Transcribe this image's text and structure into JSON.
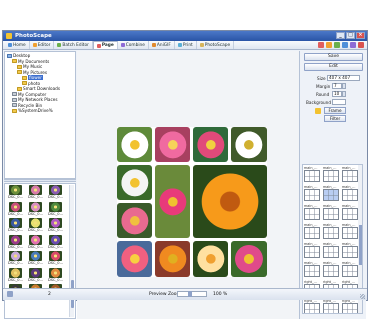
{
  "window": {
    "title": "PhotoScape"
  },
  "tabs": [
    {
      "label": "Home",
      "color": "#4f8fd9"
    },
    {
      "label": "Editor",
      "color": "#f0a030"
    },
    {
      "label": "Batch Editor",
      "color": "#6ab04c"
    },
    {
      "label": "Page",
      "color": "#e05d5d"
    },
    {
      "label": "Combine",
      "color": "#8e6bd6"
    },
    {
      "label": "AniGIF",
      "color": "#e08a2e"
    },
    {
      "label": "Print",
      "color": "#5bb0d6"
    },
    {
      "label": "PhotoScape",
      "color": "#d6b45b"
    }
  ],
  "tree": [
    {
      "label": "Desktop",
      "indent": 0,
      "kind": "blue"
    },
    {
      "label": "My Documents",
      "indent": 1,
      "kind": "yellow"
    },
    {
      "label": "My Music",
      "indent": 2,
      "kind": "yellow"
    },
    {
      "label": "My Pictures",
      "indent": 2,
      "kind": "yellow"
    },
    {
      "label": "flower",
      "indent": 3,
      "kind": "yellow",
      "selected": true
    },
    {
      "label": "photo",
      "indent": 3,
      "kind": "yellow"
    },
    {
      "label": "Smart Downloads",
      "indent": 2,
      "kind": "yellow"
    },
    {
      "label": "My Computer",
      "indent": 1,
      "kind": "gray"
    },
    {
      "label": "My Network Places",
      "indent": 1,
      "kind": "gray"
    },
    {
      "label": "Recycle Bin",
      "indent": 1,
      "kind": "gray"
    },
    {
      "label": "%SystemDrive%",
      "indent": 1,
      "kind": "yellow"
    }
  ],
  "thumbnails": [
    {
      "caption": "DSC_0...",
      "color": "#6a8e3a"
    },
    {
      "caption": "DSC_0...",
      "color": "#d67aa8"
    },
    {
      "caption": "DSC_0...",
      "color": "#8a5ab0"
    },
    {
      "caption": "DSC_0...",
      "color": "#c94f7a"
    },
    {
      "caption": "DSC_0...",
      "color": "#d88fc0"
    },
    {
      "caption": "DSC_0...",
      "color": "#4f8a3e"
    },
    {
      "caption": "DSC_0...",
      "color": "#3a5aa0"
    },
    {
      "caption": "DSC_0...",
      "color": "#e8e070"
    },
    {
      "caption": "DSC_0...",
      "color": "#b05ac0"
    },
    {
      "caption": "DSC_0...",
      "color": "#9a3a8a"
    },
    {
      "caption": "DSC_0...",
      "color": "#e070b0"
    },
    {
      "caption": "DSC_0...",
      "color": "#6a4ab0"
    },
    {
      "caption": "DSC_0...",
      "color": "#c8a8d8"
    },
    {
      "caption": "DSC_0...",
      "color": "#4a7ab8"
    },
    {
      "caption": "DSC_0...",
      "color": "#d84a6a"
    },
    {
      "caption": "DSC_0...",
      "color": "#e0c060"
    },
    {
      "caption": "DSC_0...",
      "color": "#5a3a7a"
    },
    {
      "caption": "DSC_0...",
      "color": "#e08a40"
    },
    {
      "caption": "DSCPA...",
      "color": "#3a3a3a"
    },
    {
      "caption": "DSCPA...",
      "color": "#c87a30"
    },
    {
      "caption": "DSCPA...",
      "color": "#a05a2a"
    }
  ],
  "collage_cells": [
    {
      "bg": "#5e8a3a",
      "petal": "#ffffff",
      "center": "#f2c230"
    },
    {
      "bg": "#a84060",
      "petal": "#f06aa0",
      "center": "#f6d35a"
    },
    {
      "bg": "#2f6a3a",
      "petal": "#e04a7a",
      "center": "#f0d040"
    },
    {
      "bg": "#405a2a",
      "petal": "#ffffff",
      "center": "#d0b030"
    },
    {
      "bg": "#3a6a2a",
      "petal": "#f4f4f4",
      "center": "#f2c230"
    },
    {
      "bg": "#6a8a3a",
      "petal": "#e83a7a",
      "center": "#f0c030"
    },
    {
      "bg": "#2a4a1a",
      "petal": "#f79a1a",
      "center": "#c05a10"
    },
    {
      "bg": "#3a5a2a",
      "petal": "#e86a90",
      "center": "#f0c040"
    },
    {
      "bg": "#4a6a9a",
      "petal": "#f06080",
      "center": "#f8d040"
    },
    {
      "bg": "#8a3a2a",
      "petal": "#f08a20",
      "center": "#e0b020"
    },
    {
      "bg": "#2a4a1a",
      "petal": "#ffe0a0",
      "center": "#f0a030"
    },
    {
      "bg": "#3a6a2a",
      "petal": "#e04a8a",
      "center": "#f0c030"
    },
    {
      "bg": "#4a7a2a",
      "petal": "#ffcc10",
      "center": "#e08a10"
    },
    {
      "bg": "#5a7a3a",
      "petal": "#e03a3a",
      "center": "#f0d040"
    },
    {
      "bg": "#3a5a1a",
      "petal": "#e05aa0",
      "center": "#f0c030"
    }
  ],
  "right_panel": {
    "save_label": "Save",
    "edit_label": "Edit",
    "size_label": "Size",
    "size_value": "407 x 407",
    "margin_label": "Margin",
    "margin_value": "7",
    "round_label": "Round",
    "round_value": "10",
    "background_label": "Background",
    "frame_label": "Frame",
    "filter_label": "Filter"
  },
  "layouts": [
    "main_...",
    "main_...",
    "main_...",
    "main_...",
    "main_...",
    "main_...",
    "main_...",
    "main_...",
    "main_...",
    "main_...",
    "main_...",
    "main_...",
    "main_...",
    "main_...",
    "main_...",
    "main_...",
    "main_...",
    "main_...",
    "right_...",
    "right_...",
    "right_...",
    "right_...",
    "right_...",
    "right_..."
  ],
  "status": {
    "page": "2",
    "zoom_label": "Preview Zoom",
    "zoom_value": "100 %"
  }
}
